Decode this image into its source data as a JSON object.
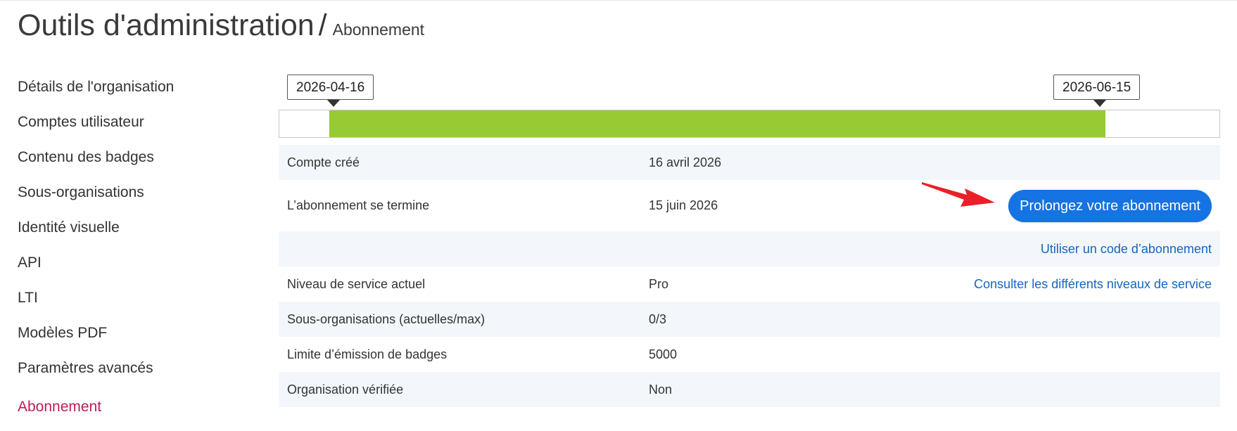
{
  "header": {
    "title": "Outils d'administration",
    "separator": "/",
    "breadcrumb": "Abonnement"
  },
  "sidebar": {
    "items": [
      {
        "label": "Détails de l'organisation",
        "active": false
      },
      {
        "label": "Comptes utilisateur",
        "active": false
      },
      {
        "label": "Contenu des badges",
        "active": false
      },
      {
        "label": "Sous-organisations",
        "active": false
      },
      {
        "label": "Identité visuelle",
        "active": false
      },
      {
        "label": "API",
        "active": false
      },
      {
        "label": "LTI",
        "active": false
      },
      {
        "label": "Modèles PDF",
        "active": false
      },
      {
        "label": "Paramètres avancés",
        "active": false
      },
      {
        "label": "Abonnement",
        "active": true
      }
    ]
  },
  "timeline": {
    "start_label": "2026-04-16",
    "end_label": "2026-06-15",
    "fill_color": "#97cb33"
  },
  "table": {
    "account_created": {
      "label": "Compte créé",
      "value": "16 avril 2026"
    },
    "subscription_ends": {
      "label": "L’abonnement se termine",
      "value": "15 juin 2026",
      "action": "Prolongez votre abonnement"
    },
    "subscription_code": {
      "link": "Utiliser un code d’abonnement"
    },
    "service_level": {
      "label": "Niveau de service actuel",
      "value": "Pro",
      "link": "Consulter les différents niveaux de service"
    },
    "sub_orgs": {
      "label": "Sous-organisations (actuelles/max)",
      "value": "0/3"
    },
    "badge_limit": {
      "label": "Limite d’émission de badges",
      "value": "5000"
    },
    "verified": {
      "label": "Organisation vérifiée",
      "value": "Non"
    }
  },
  "colors": {
    "accent_active": "#c2185b",
    "primary_button": "#1573e3",
    "link": "#1565c0",
    "annotation_arrow": "#e8202a"
  },
  "annotation": {
    "icon": "red-arrow-icon"
  }
}
